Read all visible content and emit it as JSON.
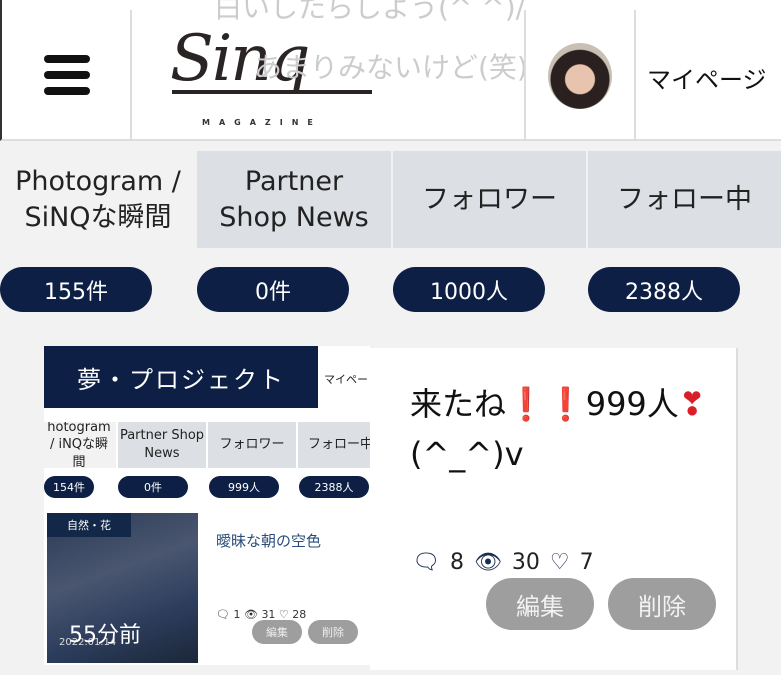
{
  "header": {
    "logo": "Sinq",
    "logo_sub": "MAGAZINE",
    "overlay_line1": "白いしたらしよう(^ ^)/",
    "overlay_line2": "あまりみないけど(笑)",
    "mypage": "マイページ"
  },
  "tabs": [
    {
      "label": "Photogram / SiNQな瞬間",
      "count": "155件"
    },
    {
      "label": "Partner Shop News",
      "count": "0件"
    },
    {
      "label": "フォロワー",
      "count": "1000人"
    },
    {
      "label": "フォロー中",
      "count": "2388人"
    }
  ],
  "shared_post": {
    "title": "夢・プロジェクト",
    "mypage": "マイペー",
    "tabs": [
      {
        "label": "hotogram / iNQな瞬間",
        "count": "154件"
      },
      {
        "label": "Partner Shop News",
        "count": "0件"
      },
      {
        "label": "フォロワー",
        "count": "999人"
      },
      {
        "label": "フォロー中",
        "count": "2388人"
      }
    ],
    "category": "自然・花",
    "time_ago": "55分前",
    "date": "2022.01.14",
    "post_title": "曖昧な朝の空色",
    "comments": "1",
    "views": "31",
    "likes": "28",
    "edit": "編集",
    "delete": "削除"
  },
  "post": {
    "text_part1": "来たね",
    "text_ex": "❗❗",
    "text_part2": "999人",
    "text_heart": "❣",
    "text_part3": "(^_^)v",
    "comments": "8",
    "views": "30",
    "likes": "7",
    "edit": "編集",
    "delete": "削除"
  },
  "colors": {
    "navy": "#0d1f45",
    "tab_gray": "#dcdfe4",
    "button_gray": "#9e9e9e"
  }
}
